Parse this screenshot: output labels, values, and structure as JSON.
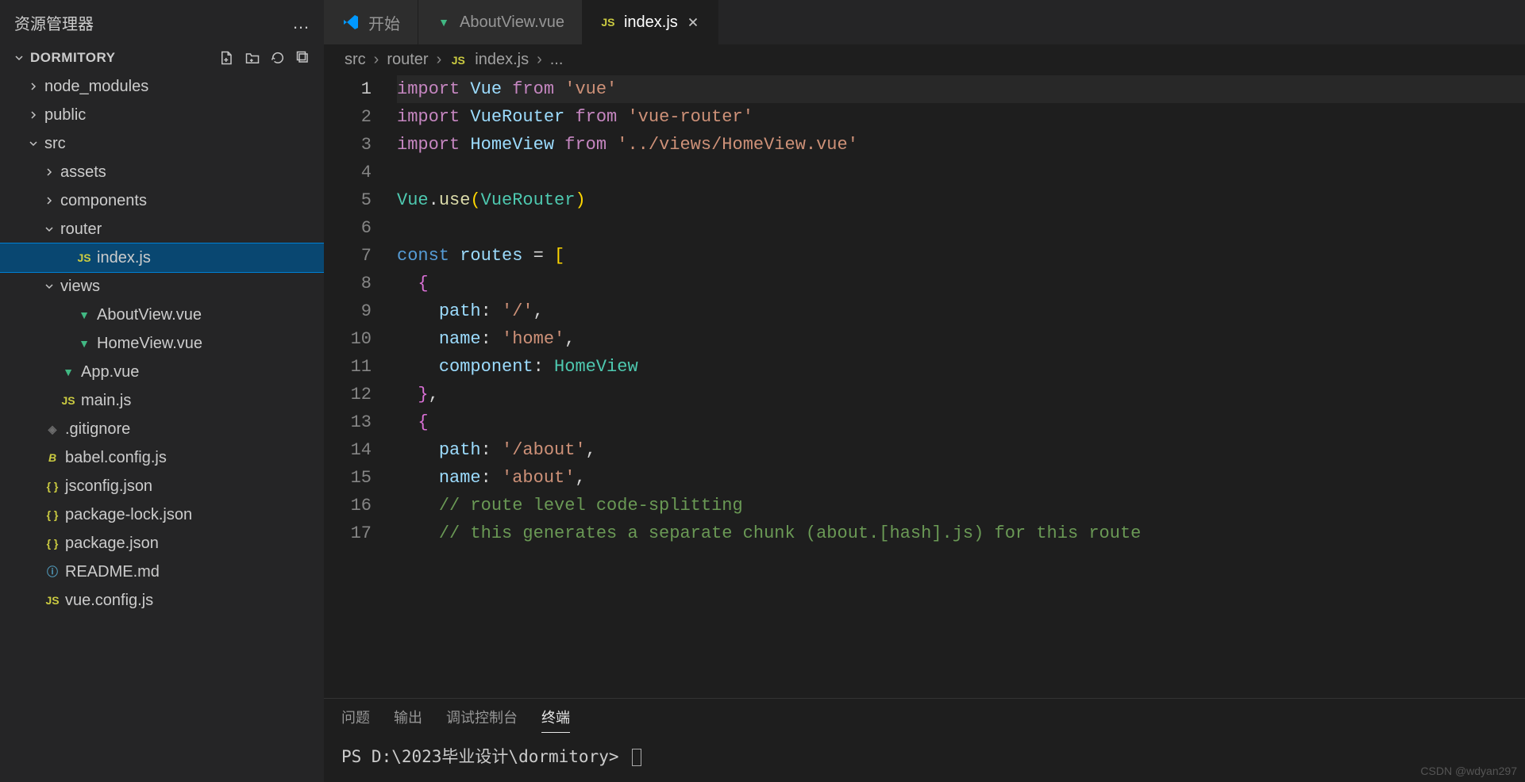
{
  "sidebar": {
    "title": "资源管理器",
    "project_name": "DORMITORY",
    "tree": [
      {
        "label": "node_modules",
        "kind": "folder",
        "closed": true,
        "indent": 0
      },
      {
        "label": "public",
        "kind": "folder",
        "closed": true,
        "indent": 0
      },
      {
        "label": "src",
        "kind": "folder",
        "closed": false,
        "indent": 0
      },
      {
        "label": "assets",
        "kind": "folder",
        "closed": true,
        "indent": 1
      },
      {
        "label": "components",
        "kind": "folder",
        "closed": true,
        "indent": 1
      },
      {
        "label": "router",
        "kind": "folder",
        "closed": false,
        "indent": 1
      },
      {
        "label": "index.js",
        "kind": "js",
        "indent": 2,
        "selected": true
      },
      {
        "label": "views",
        "kind": "folder",
        "closed": false,
        "indent": 1
      },
      {
        "label": "AboutView.vue",
        "kind": "vue",
        "indent": 2
      },
      {
        "label": "HomeView.vue",
        "kind": "vue",
        "indent": 2
      },
      {
        "label": "App.vue",
        "kind": "vue",
        "indent": 1
      },
      {
        "label": "main.js",
        "kind": "js",
        "indent": 1
      },
      {
        "label": ".gitignore",
        "kind": "git",
        "indent": 0
      },
      {
        "label": "babel.config.js",
        "kind": "babel",
        "indent": 0
      },
      {
        "label": "jsconfig.json",
        "kind": "json",
        "indent": 0
      },
      {
        "label": "package-lock.json",
        "kind": "json",
        "indent": 0
      },
      {
        "label": "package.json",
        "kind": "json",
        "indent": 0
      },
      {
        "label": "README.md",
        "kind": "readme",
        "indent": 0
      },
      {
        "label": "vue.config.js",
        "kind": "js",
        "indent": 0
      }
    ]
  },
  "tabs": [
    {
      "label": "开始",
      "icon": "vscode",
      "active": false
    },
    {
      "label": "AboutView.vue",
      "icon": "vue",
      "active": false
    },
    {
      "label": "index.js",
      "icon": "js",
      "active": true,
      "close": true
    }
  ],
  "breadcrumb": {
    "parts": [
      "src",
      "router"
    ],
    "file_icon": "js",
    "file": "index.js",
    "tail": "..."
  },
  "code": {
    "active_line": 1,
    "lines": [
      [
        [
          "kw",
          "import"
        ],
        [
          "sp",
          " "
        ],
        [
          "var",
          "Vue"
        ],
        [
          "sp",
          " "
        ],
        [
          "kw",
          "from"
        ],
        [
          "sp",
          " "
        ],
        [
          "str",
          "'vue'"
        ]
      ],
      [
        [
          "kw",
          "import"
        ],
        [
          "sp",
          " "
        ],
        [
          "var",
          "VueRouter"
        ],
        [
          "sp",
          " "
        ],
        [
          "kw",
          "from"
        ],
        [
          "sp",
          " "
        ],
        [
          "str",
          "'vue-router'"
        ]
      ],
      [
        [
          "kw",
          "import"
        ],
        [
          "sp",
          " "
        ],
        [
          "var",
          "HomeView"
        ],
        [
          "sp",
          " "
        ],
        [
          "kw",
          "from"
        ],
        [
          "sp",
          " "
        ],
        [
          "str",
          "'../views/HomeView.vue'"
        ]
      ],
      [],
      [
        [
          "type",
          "Vue"
        ],
        [
          "punct",
          "."
        ],
        [
          "func",
          "use"
        ],
        [
          "brace",
          "("
        ],
        [
          "type",
          "VueRouter"
        ],
        [
          "brace",
          ")"
        ]
      ],
      [],
      [
        [
          "const",
          "const"
        ],
        [
          "sp",
          " "
        ],
        [
          "var",
          "routes"
        ],
        [
          "sp",
          " "
        ],
        [
          "punct",
          "="
        ],
        [
          "sp",
          " "
        ],
        [
          "brace",
          "["
        ]
      ],
      [
        [
          "sp",
          "  "
        ],
        [
          "brace2",
          "{"
        ]
      ],
      [
        [
          "sp",
          "    "
        ],
        [
          "prop",
          "path"
        ],
        [
          "punct",
          ":"
        ],
        [
          "sp",
          " "
        ],
        [
          "str",
          "'/'"
        ],
        [
          "punct",
          ","
        ]
      ],
      [
        [
          "sp",
          "    "
        ],
        [
          "prop",
          "name"
        ],
        [
          "punct",
          ":"
        ],
        [
          "sp",
          " "
        ],
        [
          "str",
          "'home'"
        ],
        [
          "punct",
          ","
        ]
      ],
      [
        [
          "sp",
          "    "
        ],
        [
          "prop",
          "component"
        ],
        [
          "punct",
          ":"
        ],
        [
          "sp",
          " "
        ],
        [
          "type",
          "HomeView"
        ]
      ],
      [
        [
          "sp",
          "  "
        ],
        [
          "brace2",
          "}"
        ],
        [
          "punct",
          ","
        ]
      ],
      [
        [
          "sp",
          "  "
        ],
        [
          "brace2",
          "{"
        ]
      ],
      [
        [
          "sp",
          "    "
        ],
        [
          "prop",
          "path"
        ],
        [
          "punct",
          ":"
        ],
        [
          "sp",
          " "
        ],
        [
          "str",
          "'/about'"
        ],
        [
          "punct",
          ","
        ]
      ],
      [
        [
          "sp",
          "    "
        ],
        [
          "prop",
          "name"
        ],
        [
          "punct",
          ":"
        ],
        [
          "sp",
          " "
        ],
        [
          "str",
          "'about'"
        ],
        [
          "punct",
          ","
        ]
      ],
      [
        [
          "sp",
          "    "
        ],
        [
          "comment",
          "// route level code-splitting"
        ]
      ],
      [
        [
          "sp",
          "    "
        ],
        [
          "comment",
          "// this generates a separate chunk (about.[hash].js) for this route"
        ]
      ]
    ]
  },
  "panel": {
    "tabs": [
      "问题",
      "输出",
      "调试控制台",
      "终端"
    ],
    "active_tab": 3,
    "terminal_line": "PS D:\\2023毕业设计\\dormitory>"
  },
  "watermark": "CSDN @wdyan297"
}
